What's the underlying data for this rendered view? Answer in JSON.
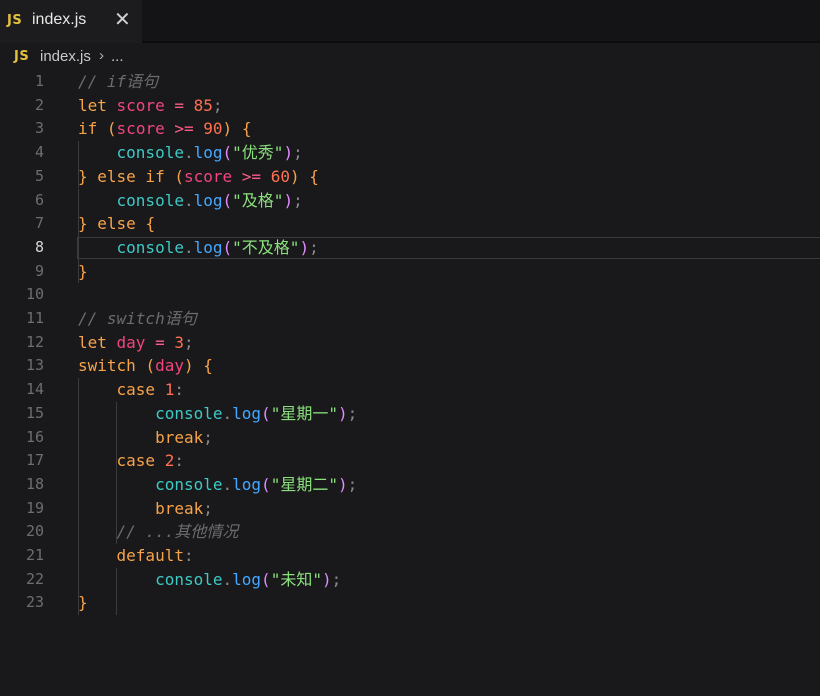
{
  "tab": {
    "badge": "JS",
    "title": "index.js",
    "close": "✕"
  },
  "breadcrumb": {
    "badge": "JS",
    "file": "index.js",
    "separator": "›",
    "more": "..."
  },
  "editor": {
    "active_line": 8,
    "lines": [
      [
        [
          "cm",
          "// if语句"
        ]
      ],
      [
        [
          "kw",
          "let "
        ],
        [
          "var",
          "score"
        ],
        [
          "plain",
          " "
        ],
        [
          "op",
          "="
        ],
        [
          "plain",
          " "
        ],
        [
          "num",
          "85"
        ],
        [
          "pun",
          ";"
        ]
      ],
      [
        [
          "kw",
          "if "
        ],
        [
          "kw",
          "("
        ],
        [
          "var",
          "score"
        ],
        [
          "plain",
          " "
        ],
        [
          "op",
          ">="
        ],
        [
          "plain",
          " "
        ],
        [
          "num",
          "90"
        ],
        [
          "kw",
          ")"
        ],
        [
          "plain",
          " "
        ],
        [
          "kw",
          "{"
        ]
      ],
      [
        [
          "plain",
          "    "
        ],
        [
          "obj",
          "console"
        ],
        [
          "pun",
          "."
        ],
        [
          "fn",
          "log"
        ],
        [
          "strq",
          "("
        ],
        [
          "str",
          "\"优秀\""
        ],
        [
          "strq",
          ")"
        ],
        [
          "pun",
          ";"
        ]
      ],
      [
        [
          "kw",
          "} "
        ],
        [
          "kw",
          "else if "
        ],
        [
          "kw",
          "("
        ],
        [
          "var",
          "score"
        ],
        [
          "plain",
          " "
        ],
        [
          "op",
          ">="
        ],
        [
          "plain",
          " "
        ],
        [
          "num",
          "60"
        ],
        [
          "kw",
          ")"
        ],
        [
          "plain",
          " "
        ],
        [
          "kw",
          "{"
        ]
      ],
      [
        [
          "plain",
          "    "
        ],
        [
          "obj",
          "console"
        ],
        [
          "pun",
          "."
        ],
        [
          "fn",
          "log"
        ],
        [
          "strq",
          "("
        ],
        [
          "str",
          "\"及格\""
        ],
        [
          "strq",
          ")"
        ],
        [
          "pun",
          ";"
        ]
      ],
      [
        [
          "kw",
          "} "
        ],
        [
          "kw",
          "else "
        ],
        [
          "kw",
          "{"
        ]
      ],
      [
        [
          "plain",
          "    "
        ],
        [
          "obj",
          "console"
        ],
        [
          "pun",
          "."
        ],
        [
          "fn",
          "log"
        ],
        [
          "strq",
          "("
        ],
        [
          "str",
          "\"不及格\""
        ],
        [
          "strq",
          ")"
        ],
        [
          "pun",
          ";"
        ]
      ],
      [
        [
          "kw",
          "}"
        ]
      ],
      [],
      [
        [
          "cm",
          "// switch语句"
        ]
      ],
      [
        [
          "kw",
          "let "
        ],
        [
          "var",
          "day"
        ],
        [
          "plain",
          " "
        ],
        [
          "op",
          "="
        ],
        [
          "plain",
          " "
        ],
        [
          "num",
          "3"
        ],
        [
          "pun",
          ";"
        ]
      ],
      [
        [
          "kw",
          "switch "
        ],
        [
          "kw",
          "("
        ],
        [
          "var",
          "day"
        ],
        [
          "kw",
          ")"
        ],
        [
          "plain",
          " "
        ],
        [
          "kw",
          "{"
        ]
      ],
      [
        [
          "plain",
          "    "
        ],
        [
          "kw",
          "case "
        ],
        [
          "num",
          "1"
        ],
        [
          "pun",
          ":"
        ]
      ],
      [
        [
          "plain",
          "        "
        ],
        [
          "obj",
          "console"
        ],
        [
          "pun",
          "."
        ],
        [
          "fn",
          "log"
        ],
        [
          "strq",
          "("
        ],
        [
          "str",
          "\"星期一\""
        ],
        [
          "strq",
          ")"
        ],
        [
          "pun",
          ";"
        ]
      ],
      [
        [
          "plain",
          "        "
        ],
        [
          "kw",
          "break"
        ],
        [
          "pun",
          ";"
        ]
      ],
      [
        [
          "plain",
          "    "
        ],
        [
          "kw",
          "case "
        ],
        [
          "num",
          "2"
        ],
        [
          "pun",
          ":"
        ]
      ],
      [
        [
          "plain",
          "        "
        ],
        [
          "obj",
          "console"
        ],
        [
          "pun",
          "."
        ],
        [
          "fn",
          "log"
        ],
        [
          "strq",
          "("
        ],
        [
          "str",
          "\"星期二\""
        ],
        [
          "strq",
          ")"
        ],
        [
          "pun",
          ";"
        ]
      ],
      [
        [
          "plain",
          "        "
        ],
        [
          "kw",
          "break"
        ],
        [
          "pun",
          ";"
        ]
      ],
      [
        [
          "plain",
          "    "
        ],
        [
          "cm",
          "// ...其他情况"
        ]
      ],
      [
        [
          "plain",
          "    "
        ],
        [
          "kw",
          "default"
        ],
        [
          "pun",
          ":"
        ]
      ],
      [
        [
          "plain",
          "        "
        ],
        [
          "obj",
          "console"
        ],
        [
          "pun",
          "."
        ],
        [
          "fn",
          "log"
        ],
        [
          "strq",
          "("
        ],
        [
          "str",
          "\"未知\""
        ],
        [
          "strq",
          ")"
        ],
        [
          "pun",
          ";"
        ]
      ],
      [
        [
          "kw",
          "}"
        ]
      ]
    ]
  }
}
